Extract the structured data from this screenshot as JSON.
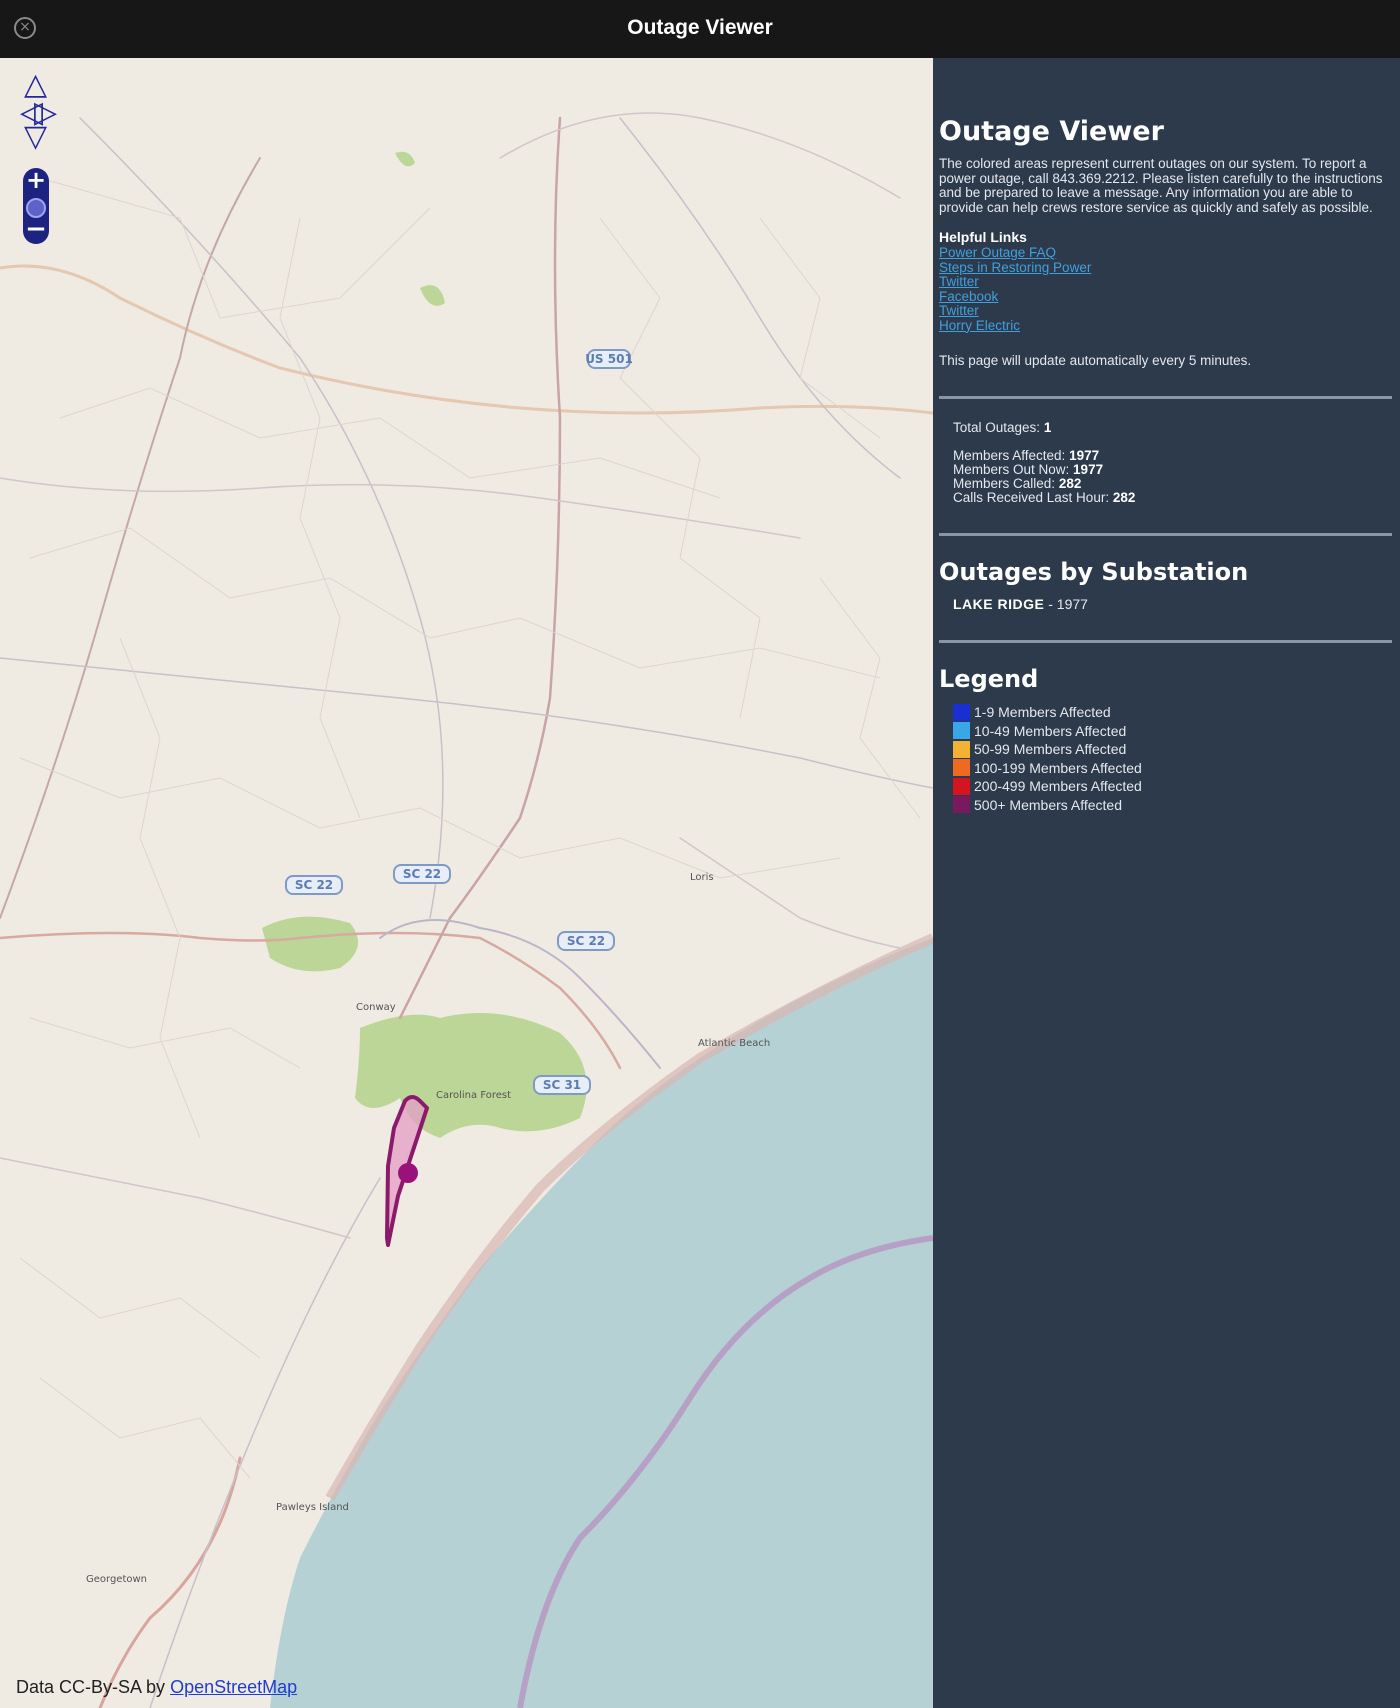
{
  "window": {
    "title": "Outage Viewer",
    "close_icon": "close-icon"
  },
  "map": {
    "attribution_prefix": "Data CC-By-SA by",
    "attribution_link": "OpenStreetMap",
    "route_shields": [
      "US 501",
      "SC 22",
      "SC 22",
      "SC 22",
      "SC 31"
    ],
    "place_labels": [
      "Conway",
      "Carolina Forest",
      "Atlantic Beach",
      "Loris",
      "Pawleys Island",
      "Georgetown"
    ],
    "outage_color": "#8b1a6b"
  },
  "panel": {
    "heading": "Outage Viewer",
    "intro": "The colored areas represent current outages on our system. To report a power outage, call 843.369.2212. Please listen carefully to the instructions and be prepared to leave a message. Any information you are able to provide can help crews restore service as quickly and safely as possible.",
    "links_title": "Helpful Links",
    "links": [
      "Power Outage FAQ",
      "Steps in Restoring Power",
      "Twitter",
      "Facebook",
      "Twitter",
      "Horry Electric"
    ],
    "update_note": "This page will update automatically every 5 minutes.",
    "stats": {
      "total_outages_label": "Total Outages:",
      "total_outages": "1",
      "members_affected_label": "Members Affected:",
      "members_affected": "1977",
      "members_out_now_label": "Members Out Now:",
      "members_out_now": "1977",
      "members_called_label": "Members Called:",
      "members_called": "282",
      "calls_last_hour_label": "Calls Received Last Hour:",
      "calls_last_hour": "282"
    },
    "substation_heading": "Outages by Substation",
    "substations": [
      {
        "name": "LAKE RIDGE",
        "count": "1977"
      }
    ],
    "legend_heading": "Legend",
    "legend": [
      {
        "label": "1-9 Members Affected",
        "color": "#1a2fd0"
      },
      {
        "label": "10-49 Members Affected",
        "color": "#3aa6ea"
      },
      {
        "label": "50-99 Members Affected",
        "color": "#f2b233"
      },
      {
        "label": "100-199 Members Affected",
        "color": "#ee6a22"
      },
      {
        "label": "200-499 Members Affected",
        "color": "#d4141e"
      },
      {
        "label": "500+ Members Affected",
        "color": "#7a1a5e"
      }
    ]
  }
}
